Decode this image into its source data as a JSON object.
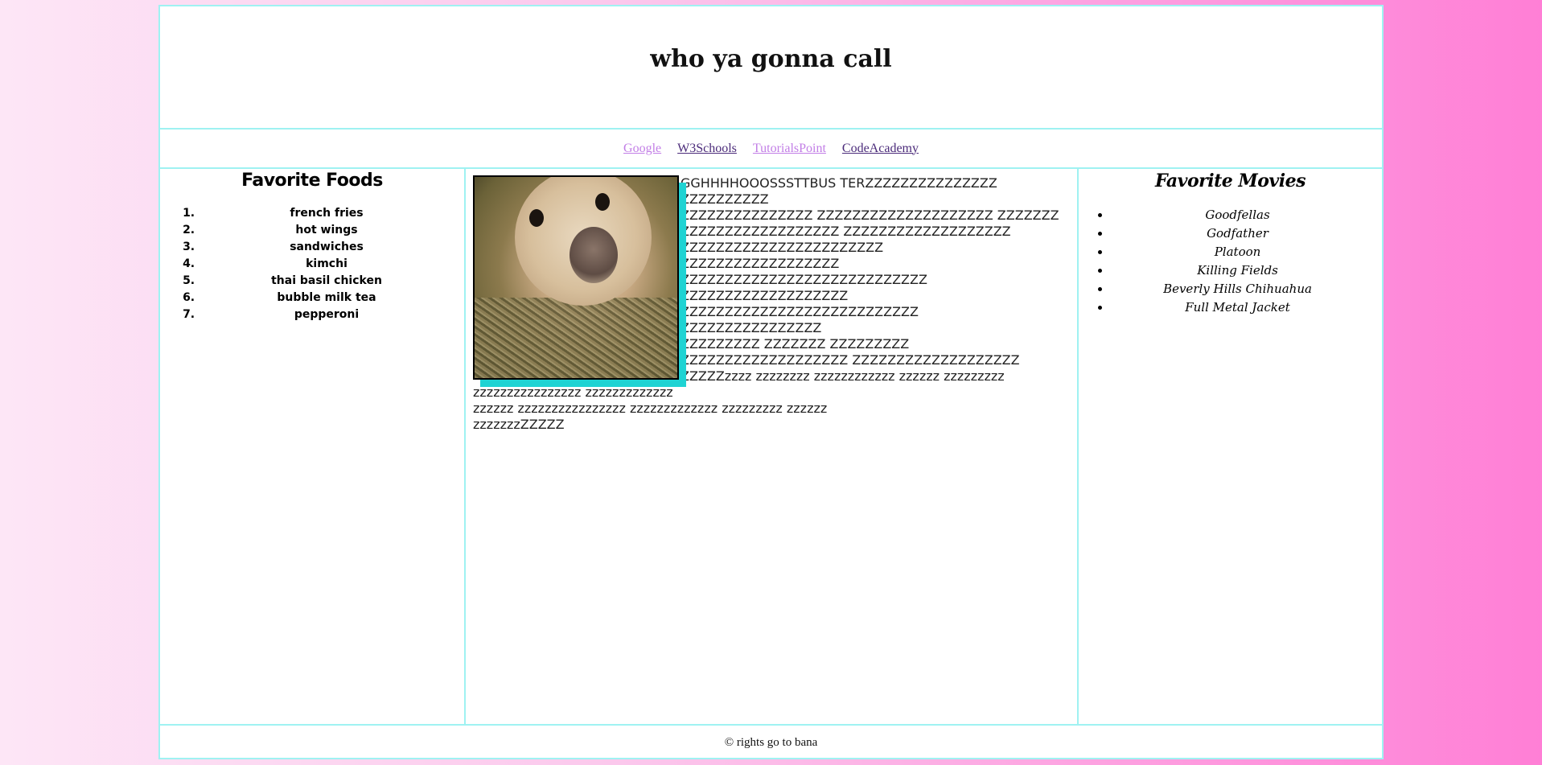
{
  "header": {
    "title": "who ya gonna call"
  },
  "nav": {
    "links": [
      {
        "label": "Google",
        "color": "#c27ee6"
      },
      {
        "label": "W3Schools",
        "color": "#4b2b7a"
      },
      {
        "label": "TutorialsPoint",
        "color": "#c27ee6"
      },
      {
        "label": "CodeAcademy",
        "color": "#4b2b7a"
      }
    ]
  },
  "left": {
    "heading": "Favorite Foods",
    "items": [
      "french fries",
      "hot wings",
      "sandwiches",
      "kimchi",
      "thai basil chicken",
      "bubble milk tea",
      "pepperoni"
    ]
  },
  "main": {
    "image": "alpaca-photo",
    "text_lines": [
      "GGHHHHOOOSSSTTBUS TERZZZZZZZZZZZZZZZ",
      "ZZZZZZZZZZ",
      "ZZZZZZZZZZZZZZZ ZZZZZZZZZZZZZZZZZZZZ ZZZZZZZ",
      "ZZZZZZZZZZZZZZZZZZ ZZZZZZZZZZZZZZZZZZZ",
      "ZZZZZZZZZZZZZZZZZZZZZZZ",
      "ZZZZZZZZZZZZZZZZZZ",
      "ZZZZZZZZZZZZZZZZZZZZZZZZZZZZ",
      "ZZZZZZZZZZZZZZZZZZZ",
      "ZZZZZZZZZZZZZZZZZZZZZZZZZZZ",
      "ZZZZZZZZZZZZZZZZ",
      "ZZZZZZZZZ ZZZZZZZ ZZZZZZZZZ",
      "ZZZZZZZZZZZZZZZZZZZ ZZZZZZZZZZZZZZZZZZZ",
      "ZZZZZzzzz zzzzzzzz zzzzzzzzzzzz zzzzzz zzzzzzzzz",
      "zzzzzzzzzzzzzzzz zzzzzzzzzzzzz",
      "zzzzzz zzzzzzzzzzzzzzzz zzzzzzzzzzzzz zzzzzzzzz zzzzzz",
      "zzzzzzzZZZZZ"
    ]
  },
  "right": {
    "heading": "Favorite Movies",
    "items": [
      "Goodfellas",
      "Godfather",
      "Platoon",
      "Killing Fields",
      "Beverly Hills Chihuahua",
      "Full Metal Jacket"
    ]
  },
  "footer": {
    "text": "© rights go to bana"
  },
  "colors": {
    "border": "#9ff2f2",
    "image_shadow": "#1fd3d3",
    "background_start": "#fde6f6",
    "background_end": "#ff7fd6"
  }
}
